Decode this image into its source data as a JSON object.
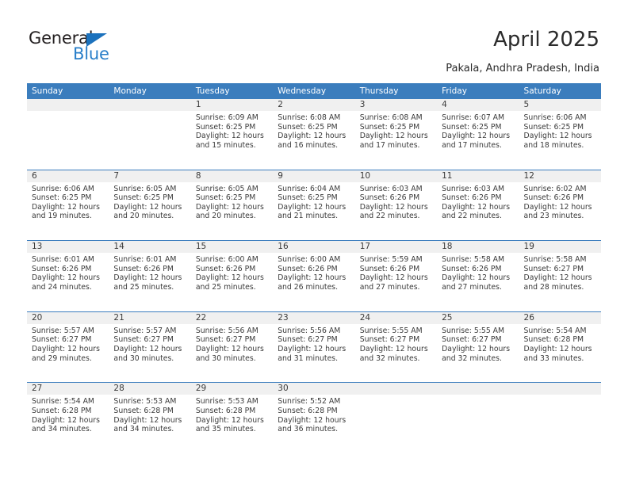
{
  "brand": {
    "name_part1": "General",
    "name_part2": "Blue",
    "triangle_icon": "blue-triangle-icon",
    "accent_color": "#1c72bd",
    "blue_text_color": "#2a7fc9"
  },
  "header": {
    "title": "April 2025",
    "subtitle": "Pakala, Andhra Pradesh, India"
  },
  "calendar": {
    "header_bg_color": "#3b7dbd",
    "daynum_band_color": "#f0f0f0",
    "weekday_headers": [
      "Sunday",
      "Monday",
      "Tuesday",
      "Wednesday",
      "Thursday",
      "Friday",
      "Saturday"
    ],
    "weeks": [
      [
        {
          "day": "",
          "sunrise": "",
          "sunset": "",
          "daylight": "",
          "empty": true
        },
        {
          "day": "",
          "sunrise": "",
          "sunset": "",
          "daylight": "",
          "empty": true
        },
        {
          "day": "1",
          "sunrise": "Sunrise: 6:09 AM",
          "sunset": "Sunset: 6:25 PM",
          "daylight": "Daylight: 12 hours and 15 minutes."
        },
        {
          "day": "2",
          "sunrise": "Sunrise: 6:08 AM",
          "sunset": "Sunset: 6:25 PM",
          "daylight": "Daylight: 12 hours and 16 minutes."
        },
        {
          "day": "3",
          "sunrise": "Sunrise: 6:08 AM",
          "sunset": "Sunset: 6:25 PM",
          "daylight": "Daylight: 12 hours and 17 minutes."
        },
        {
          "day": "4",
          "sunrise": "Sunrise: 6:07 AM",
          "sunset": "Sunset: 6:25 PM",
          "daylight": "Daylight: 12 hours and 17 minutes."
        },
        {
          "day": "5",
          "sunrise": "Sunrise: 6:06 AM",
          "sunset": "Sunset: 6:25 PM",
          "daylight": "Daylight: 12 hours and 18 minutes."
        }
      ],
      [
        {
          "day": "6",
          "sunrise": "Sunrise: 6:06 AM",
          "sunset": "Sunset: 6:25 PM",
          "daylight": "Daylight: 12 hours and 19 minutes."
        },
        {
          "day": "7",
          "sunrise": "Sunrise: 6:05 AM",
          "sunset": "Sunset: 6:25 PM",
          "daylight": "Daylight: 12 hours and 20 minutes."
        },
        {
          "day": "8",
          "sunrise": "Sunrise: 6:05 AM",
          "sunset": "Sunset: 6:25 PM",
          "daylight": "Daylight: 12 hours and 20 minutes."
        },
        {
          "day": "9",
          "sunrise": "Sunrise: 6:04 AM",
          "sunset": "Sunset: 6:25 PM",
          "daylight": "Daylight: 12 hours and 21 minutes."
        },
        {
          "day": "10",
          "sunrise": "Sunrise: 6:03 AM",
          "sunset": "Sunset: 6:26 PM",
          "daylight": "Daylight: 12 hours and 22 minutes."
        },
        {
          "day": "11",
          "sunrise": "Sunrise: 6:03 AM",
          "sunset": "Sunset: 6:26 PM",
          "daylight": "Daylight: 12 hours and 22 minutes."
        },
        {
          "day": "12",
          "sunrise": "Sunrise: 6:02 AM",
          "sunset": "Sunset: 6:26 PM",
          "daylight": "Daylight: 12 hours and 23 minutes."
        }
      ],
      [
        {
          "day": "13",
          "sunrise": "Sunrise: 6:01 AM",
          "sunset": "Sunset: 6:26 PM",
          "daylight": "Daylight: 12 hours and 24 minutes."
        },
        {
          "day": "14",
          "sunrise": "Sunrise: 6:01 AM",
          "sunset": "Sunset: 6:26 PM",
          "daylight": "Daylight: 12 hours and 25 minutes."
        },
        {
          "day": "15",
          "sunrise": "Sunrise: 6:00 AM",
          "sunset": "Sunset: 6:26 PM",
          "daylight": "Daylight: 12 hours and 25 minutes."
        },
        {
          "day": "16",
          "sunrise": "Sunrise: 6:00 AM",
          "sunset": "Sunset: 6:26 PM",
          "daylight": "Daylight: 12 hours and 26 minutes."
        },
        {
          "day": "17",
          "sunrise": "Sunrise: 5:59 AM",
          "sunset": "Sunset: 6:26 PM",
          "daylight": "Daylight: 12 hours and 27 minutes."
        },
        {
          "day": "18",
          "sunrise": "Sunrise: 5:58 AM",
          "sunset": "Sunset: 6:26 PM",
          "daylight": "Daylight: 12 hours and 27 minutes."
        },
        {
          "day": "19",
          "sunrise": "Sunrise: 5:58 AM",
          "sunset": "Sunset: 6:27 PM",
          "daylight": "Daylight: 12 hours and 28 minutes."
        }
      ],
      [
        {
          "day": "20",
          "sunrise": "Sunrise: 5:57 AM",
          "sunset": "Sunset: 6:27 PM",
          "daylight": "Daylight: 12 hours and 29 minutes."
        },
        {
          "day": "21",
          "sunrise": "Sunrise: 5:57 AM",
          "sunset": "Sunset: 6:27 PM",
          "daylight": "Daylight: 12 hours and 30 minutes."
        },
        {
          "day": "22",
          "sunrise": "Sunrise: 5:56 AM",
          "sunset": "Sunset: 6:27 PM",
          "daylight": "Daylight: 12 hours and 30 minutes."
        },
        {
          "day": "23",
          "sunrise": "Sunrise: 5:56 AM",
          "sunset": "Sunset: 6:27 PM",
          "daylight": "Daylight: 12 hours and 31 minutes."
        },
        {
          "day": "24",
          "sunrise": "Sunrise: 5:55 AM",
          "sunset": "Sunset: 6:27 PM",
          "daylight": "Daylight: 12 hours and 32 minutes."
        },
        {
          "day": "25",
          "sunrise": "Sunrise: 5:55 AM",
          "sunset": "Sunset: 6:27 PM",
          "daylight": "Daylight: 12 hours and 32 minutes."
        },
        {
          "day": "26",
          "sunrise": "Sunrise: 5:54 AM",
          "sunset": "Sunset: 6:28 PM",
          "daylight": "Daylight: 12 hours and 33 minutes."
        }
      ],
      [
        {
          "day": "27",
          "sunrise": "Sunrise: 5:54 AM",
          "sunset": "Sunset: 6:28 PM",
          "daylight": "Daylight: 12 hours and 34 minutes."
        },
        {
          "day": "28",
          "sunrise": "Sunrise: 5:53 AM",
          "sunset": "Sunset: 6:28 PM",
          "daylight": "Daylight: 12 hours and 34 minutes."
        },
        {
          "day": "29",
          "sunrise": "Sunrise: 5:53 AM",
          "sunset": "Sunset: 6:28 PM",
          "daylight": "Daylight: 12 hours and 35 minutes."
        },
        {
          "day": "30",
          "sunrise": "Sunrise: 5:52 AM",
          "sunset": "Sunset: 6:28 PM",
          "daylight": "Daylight: 12 hours and 36 minutes."
        },
        {
          "day": "",
          "sunrise": "",
          "sunset": "",
          "daylight": "",
          "empty": true
        },
        {
          "day": "",
          "sunrise": "",
          "sunset": "",
          "daylight": "",
          "empty": true
        },
        {
          "day": "",
          "sunrise": "",
          "sunset": "",
          "daylight": "",
          "empty": true
        }
      ]
    ]
  }
}
